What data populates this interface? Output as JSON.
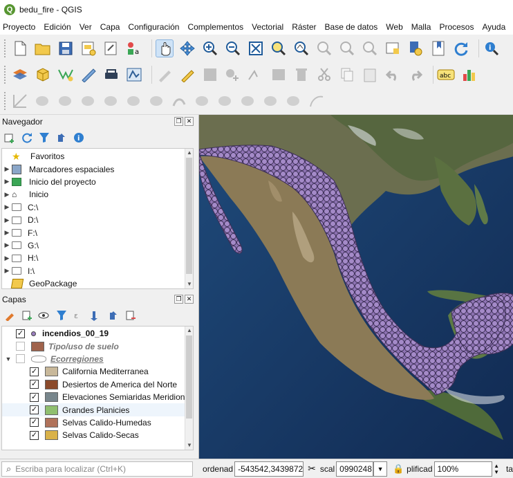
{
  "window": {
    "title": "bedu_fire - QGIS",
    "app_icon": "Q"
  },
  "menu": [
    "Proyecto",
    "Edición",
    "Ver",
    "Capa",
    "Configuración",
    "Complementos",
    "Vectorial",
    "Ráster",
    "Base de datos",
    "Web",
    "Malla",
    "Procesos",
    "Ayuda"
  ],
  "navigator": {
    "title": "Navegador",
    "items": [
      {
        "label": "Favoritos",
        "icon": "star-icon",
        "arrow": ""
      },
      {
        "label": "Marcadores espaciales",
        "icon": "bookmarks-icon",
        "arrow": "▶"
      },
      {
        "label": "Inicio del proyecto",
        "icon": "project-home-icon",
        "arrow": "▶"
      },
      {
        "label": "Inicio",
        "icon": "home-icon",
        "arrow": "▶"
      },
      {
        "label": "C:\\",
        "icon": "folder-icon",
        "arrow": "▶"
      },
      {
        "label": "D:\\",
        "icon": "folder-icon",
        "arrow": "▶"
      },
      {
        "label": "F:\\",
        "icon": "folder-icon",
        "arrow": "▶"
      },
      {
        "label": "G:\\",
        "icon": "folder-icon",
        "arrow": "▶"
      },
      {
        "label": "H:\\",
        "icon": "folder-icon",
        "arrow": "▶"
      },
      {
        "label": "I:\\",
        "icon": "folder-icon",
        "arrow": "▶"
      },
      {
        "label": "GeoPackage",
        "icon": "geopackage-icon",
        "arrow": ""
      }
    ]
  },
  "layers": {
    "title": "Capas",
    "incendios": "incendios_00_19",
    "tipo": "Tipo/uso de suelo",
    "ecorregiones": "Ecorregiones",
    "classes": [
      {
        "label": "California Mediterranea",
        "color": "#c8b89a"
      },
      {
        "label": "Desiertos de America del Norte",
        "color": "#8b4a2b"
      },
      {
        "label": "Elevaciones Semiaridas Meridionales",
        "color": "#78868c"
      },
      {
        "label": "Grandes Planicies",
        "color": "#8fbf6f"
      },
      {
        "label": "Selvas Calido-Humedas",
        "color": "#b0725a"
      },
      {
        "label": "Selvas Calido-Secas",
        "color": "#d9b24a"
      }
    ],
    "point_color": "#9b7fc0",
    "tipo_color": "#a0634c"
  },
  "status": {
    "search_placeholder": "Escriba para localizar (Ctrl+K)",
    "coord_label": "ordenad",
    "coord_value": "-543542,3439872",
    "scale_label": "scal",
    "scale_value": "0990248",
    "magnifier_label": "plificad",
    "magnifier_value": "100%",
    "rotation_label": "ta"
  }
}
